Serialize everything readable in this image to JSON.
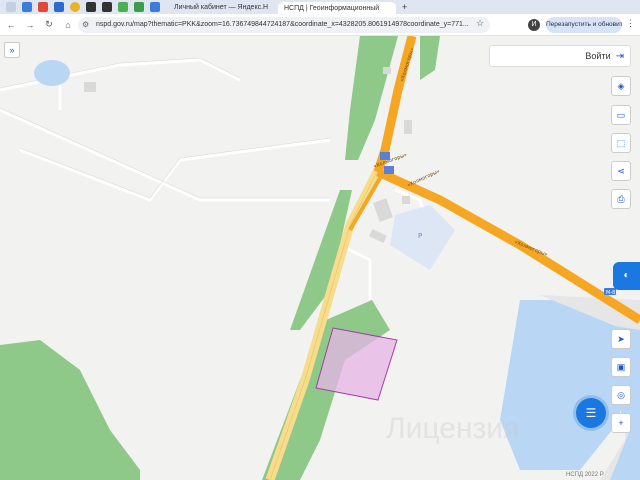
{
  "browser": {
    "tabs": [
      {
        "label": "Личный кабинет — Яндекс.Н",
        "active": false
      },
      {
        "label": "НСПД | Геоинформационный",
        "active": true
      }
    ],
    "new_tab": "+",
    "url": "nspd.gov.ru/map?thematic=PKK&zoom=16.736749844724187&coordinate_x=4328205.8061914978coordinate_y=771...",
    "profile_initial": "И",
    "restart_label": "Перезапустить и обновить"
  },
  "map": {
    "login_label": "Войти",
    "road_labels": [
      "«Холмогоры»",
      "«Холмогоры»",
      "«Холмогоры»"
    ],
    "road_badge": "М-8",
    "parking_label": "P",
    "watermark": "Лицензия",
    "copyright": "НСПД 2022 Р",
    "colors": {
      "background": "#f2f2f0",
      "forest": "#8fc98a",
      "water": "#b9d6f5",
      "main_road": "#f5a623",
      "secondary_road": "#f7dc8c",
      "parcel_fill": "#e6b4e6",
      "parcel_stroke": "#a33fa3",
      "accent": "#1a78e0"
    },
    "icons": [
      "expand-icon",
      "login-icon",
      "layers-icon",
      "ruler-icon",
      "select-area-icon",
      "share-icon",
      "print-icon",
      "navigate-icon",
      "legend-icon",
      "geo-search-icon",
      "zoom-in-icon",
      "chat-icon",
      "assistant-icon"
    ]
  }
}
